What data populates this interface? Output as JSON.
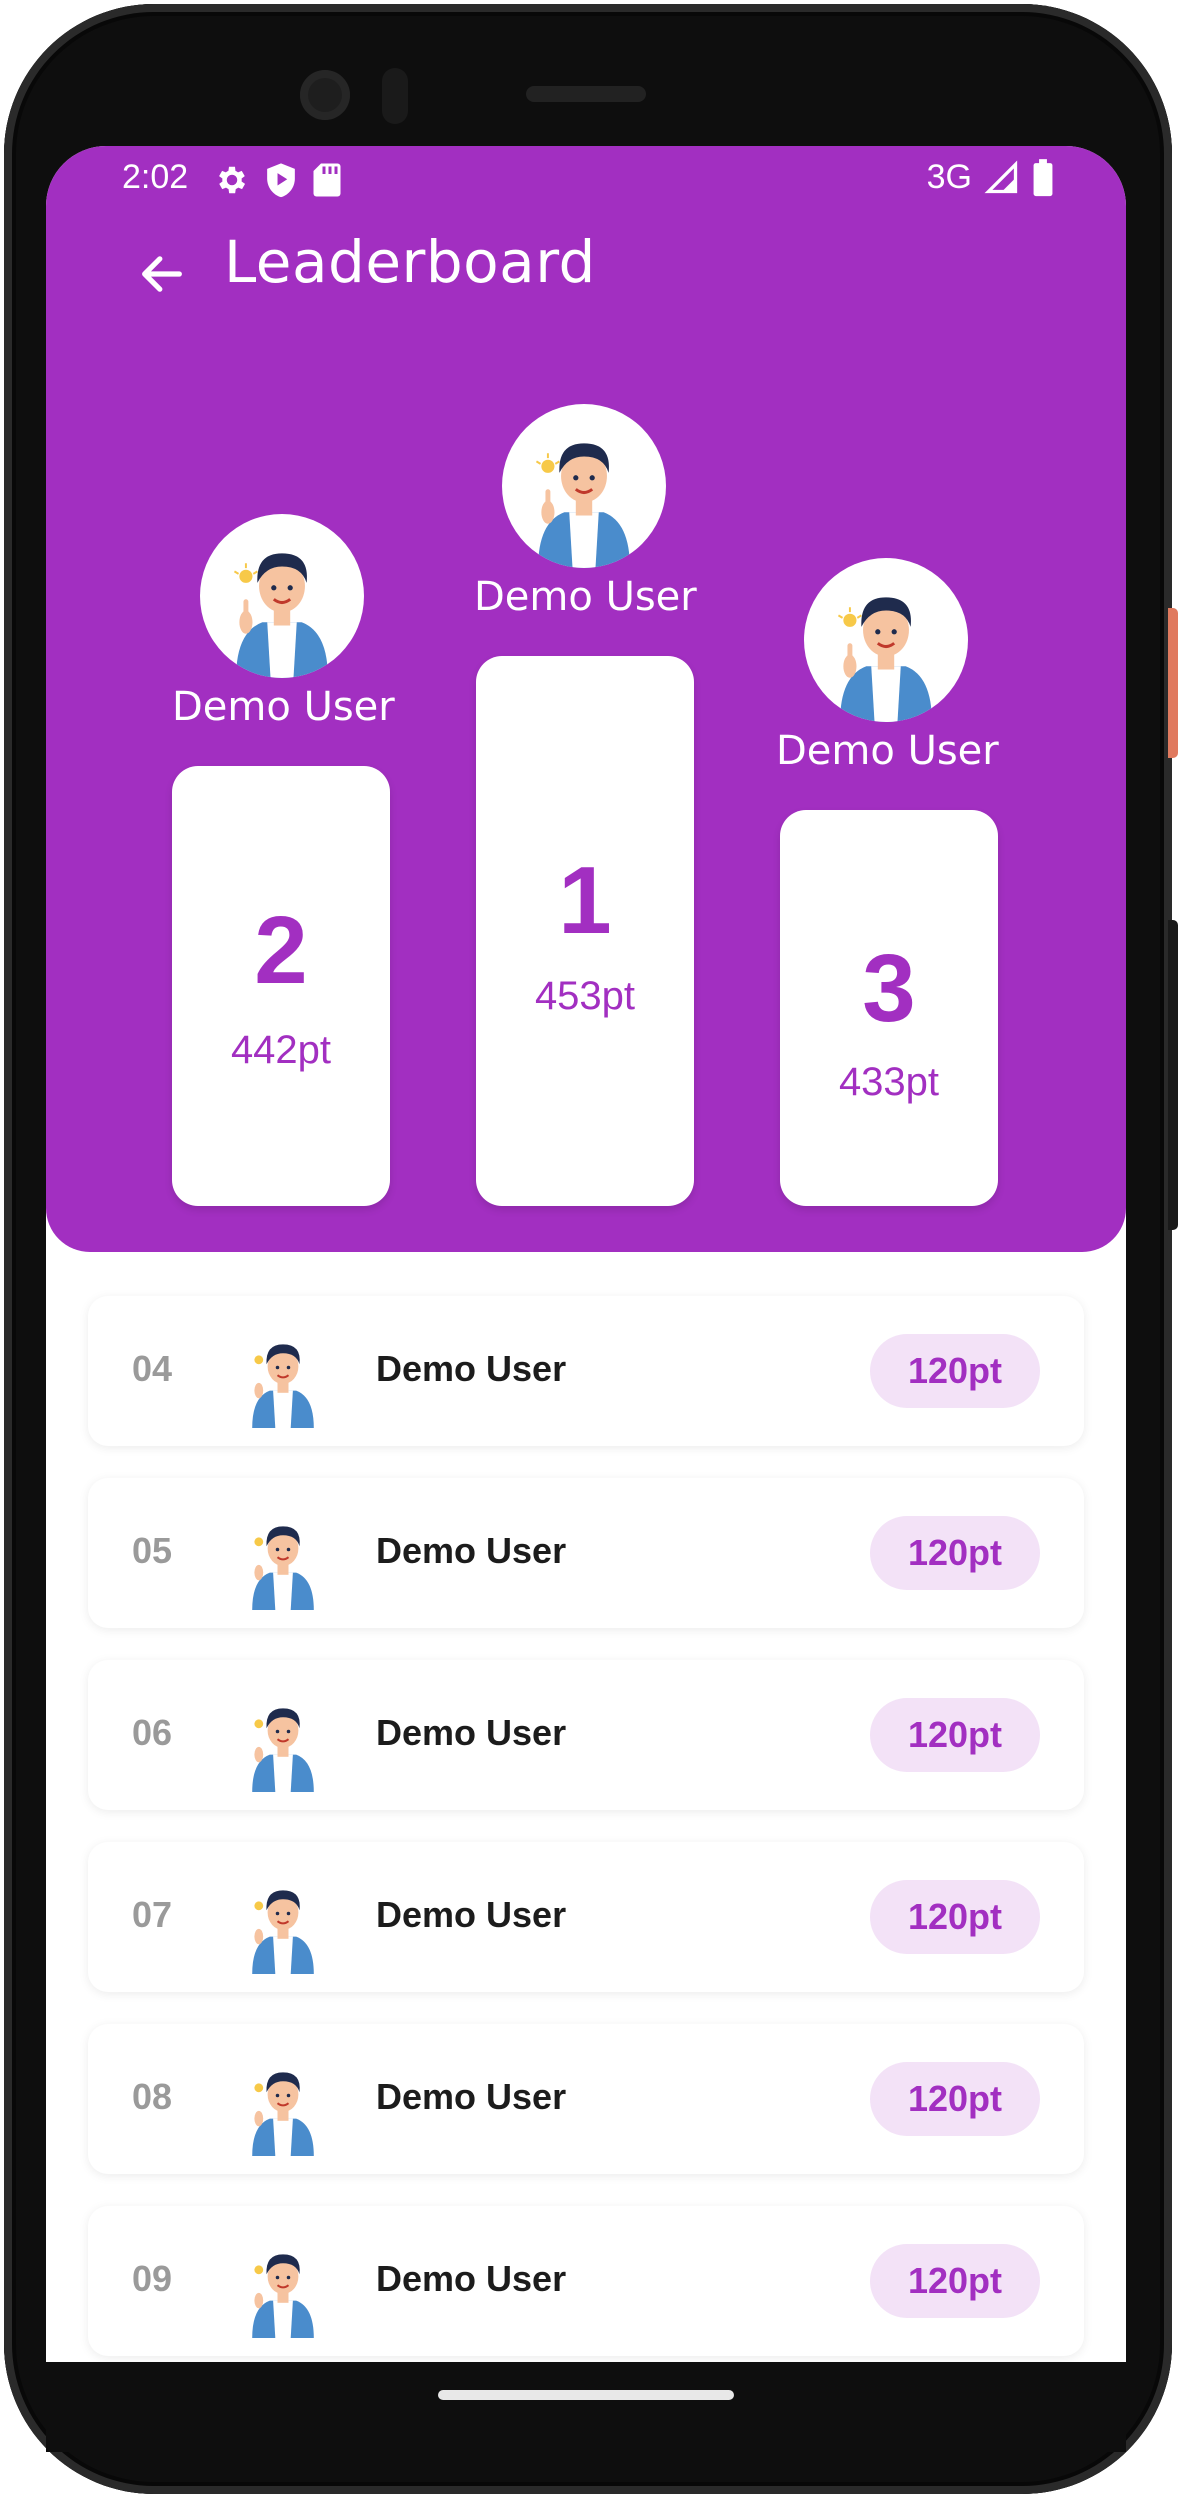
{
  "status_bar": {
    "time": "2:02",
    "network": "3G",
    "icons_left": [
      "gear-icon",
      "shield-play-icon",
      "sd-card-icon"
    ],
    "icons_right": [
      "signal-icon",
      "battery-icon"
    ]
  },
  "app_bar": {
    "title": "Leaderboard",
    "back_icon": "arrow-left-icon"
  },
  "podium": {
    "first": {
      "name": "Demo User",
      "rank": "1",
      "points": "453pt"
    },
    "second": {
      "name": "Demo User",
      "rank": "2",
      "points": "442pt"
    },
    "third": {
      "name": "Demo User",
      "rank": "3",
      "points": "433pt"
    }
  },
  "list": [
    {
      "rank": "04",
      "name": "Demo User",
      "points": "120pt"
    },
    {
      "rank": "05",
      "name": "Demo User",
      "points": "120pt"
    },
    {
      "rank": "06",
      "name": "Demo User",
      "points": "120pt"
    },
    {
      "rank": "07",
      "name": "Demo User",
      "points": "120pt"
    },
    {
      "rank": "08",
      "name": "Demo User",
      "points": "120pt"
    },
    {
      "rank": "09",
      "name": "Demo User",
      "points": "120pt"
    }
  ],
  "colors": {
    "primary": "#a22fc1",
    "badge_bg": "#f3e2f7",
    "rank_gray": "#9a9a9a"
  }
}
